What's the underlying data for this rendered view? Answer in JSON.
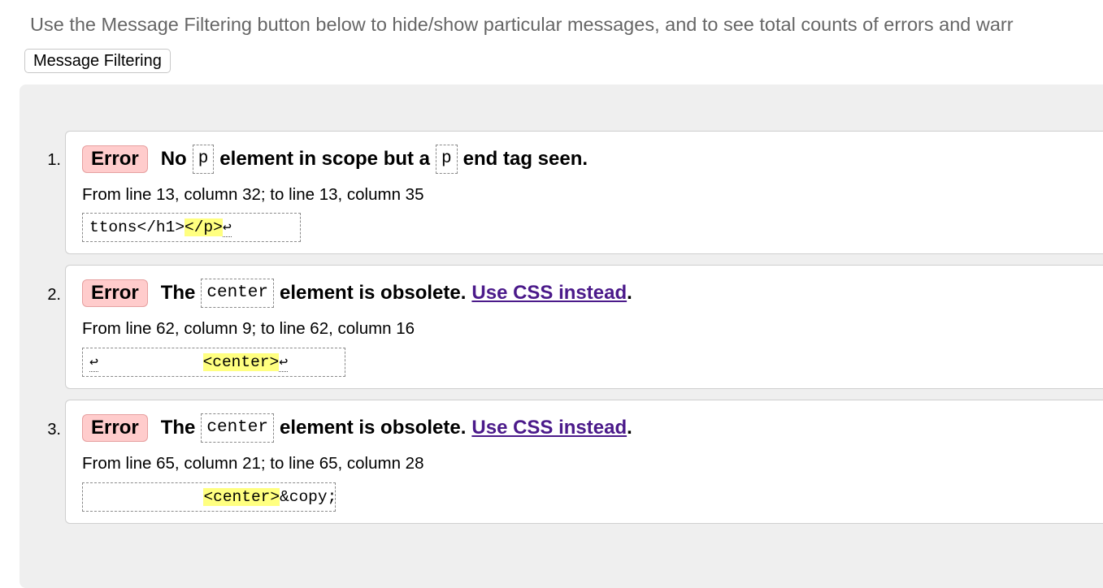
{
  "intro_text": "Use the Message Filtering button below to hide/show particular messages, and to see total counts of errors and warr",
  "filter_button_label": "Message Filtering",
  "messages": [
    {
      "number": "1.",
      "type": "Error",
      "text1": "No",
      "code1": "p",
      "text2": "element in scope but a",
      "code2": "p",
      "text3": "end tag seen.",
      "location": "From line 13, column 32; to line 13, column 35",
      "extract_before": "ttons</h1>",
      "extract_highlight": "</p>",
      "extract_after": "",
      "return_symbol": "↩"
    },
    {
      "number": "2.",
      "type": "Error",
      "text1": "The",
      "code1": "center",
      "text2": "element is obsolete.",
      "link": "Use CSS instead",
      "text3": ".",
      "location": "From line 62, column 9; to line 62, column 16",
      "extract_leading_return": "↩",
      "extract_before": "           ",
      "extract_highlight": "<center>",
      "return_symbol": "↩"
    },
    {
      "number": "3.",
      "type": "Error",
      "text1": "The",
      "code1": "center",
      "text2": "element is obsolete.",
      "link": "Use CSS instead",
      "text3": ".",
      "location": "From line 65, column 21; to line 65, column 28",
      "extract_before": "            ",
      "extract_highlight": "<center>",
      "extract_after": "&copy;"
    }
  ],
  "colors": {
    "error_badge_bg": "#ffcccc",
    "highlight": "#ffff80",
    "link": "#4b1a8a",
    "panel_bg": "#efefef"
  }
}
